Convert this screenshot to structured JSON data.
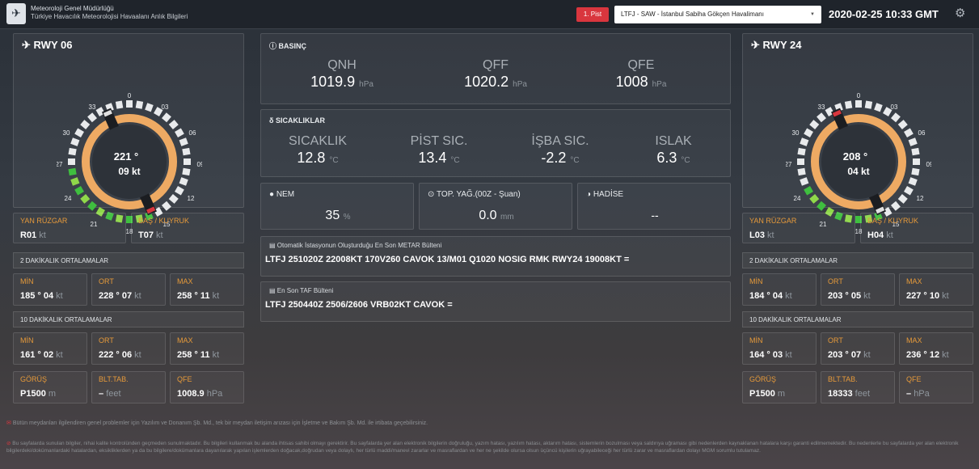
{
  "header": {
    "org_line1": "Meteoroloji Genel Müdürlüğü",
    "org_line2": "Türkiye Havacılık Meteorolojisi Havaalanı Anlık Bilgileri",
    "runway_button": "1. Pist",
    "airport_selected": "LTFJ - SAW - İstanbul Sabiha Gökçen Havalimanı",
    "datetime": "2020-02-25 10:33 GMT"
  },
  "left": {
    "title": "RWY 06",
    "wind_dir": "221 °",
    "wind_speed": "09 kt",
    "dial_labels": {
      "n0": "0",
      "n03": "03",
      "n06": "06",
      "n09": "09",
      "n12": "12",
      "n15": "15",
      "n18": "18",
      "n21": "21",
      "n24": "24",
      "n27": "27",
      "n30": "30",
      "n33": "33"
    },
    "crosswind": {
      "label": "YAN RÜZGAR",
      "value": "R01",
      "unit": "kt"
    },
    "headtail": {
      "label": "BAŞ / KUYRUK",
      "value": "T07",
      "unit": "kt"
    },
    "avg2_title": "2 DAKİKALIK ORTALAMALAR",
    "avg2": [
      {
        "label": "MİN",
        "value": "185 ° 04",
        "unit": "kt"
      },
      {
        "label": "ORT",
        "value": "228 ° 07",
        "unit": "kt"
      },
      {
        "label": "MAX",
        "value": "258 ° 11",
        "unit": "kt"
      }
    ],
    "avg10_title": "10 DAKİKALIK ORTALAMALAR",
    "avg10": [
      {
        "label": "MİN",
        "value": "161 ° 02",
        "unit": "kt"
      },
      {
        "label": "ORT",
        "value": "222 ° 06",
        "unit": "kt"
      },
      {
        "label": "MAX",
        "value": "258 ° 11",
        "unit": "kt"
      }
    ],
    "extra": [
      {
        "label": "GÖRÜŞ",
        "value": "P1500",
        "unit": "m"
      },
      {
        "label": "BLT.TAB.",
        "value": "–",
        "unit": "feet"
      },
      {
        "label": "QFE",
        "value": "1008.9",
        "unit": "hPa"
      }
    ]
  },
  "right": {
    "title": "RWY 24",
    "wind_dir": "208 °",
    "wind_speed": "04 kt",
    "dial_labels": {
      "n0": "0",
      "n03": "03",
      "n06": "06",
      "n09": "09",
      "n12": "12",
      "n15": "15",
      "n18": "18",
      "n21": "21",
      "n24": "24",
      "n27": "27",
      "n30": "30",
      "n33": "33"
    },
    "crosswind": {
      "label": "YAN RÜZGAR",
      "value": "L03",
      "unit": "kt"
    },
    "headtail": {
      "label": "BAŞ / KUYRUK",
      "value": "H04",
      "unit": "kt"
    },
    "avg2_title": "2 DAKİKALIK ORTALAMALAR",
    "avg2": [
      {
        "label": "MİN",
        "value": "184 ° 04",
        "unit": "kt"
      },
      {
        "label": "ORT",
        "value": "203 ° 05",
        "unit": "kt"
      },
      {
        "label": "MAX",
        "value": "227 ° 10",
        "unit": "kt"
      }
    ],
    "avg10_title": "10 DAKİKALIK ORTALAMALAR",
    "avg10": [
      {
        "label": "MİN",
        "value": "164 ° 03",
        "unit": "kt"
      },
      {
        "label": "ORT",
        "value": "203 ° 07",
        "unit": "kt"
      },
      {
        "label": "MAX",
        "value": "236 ° 12",
        "unit": "kt"
      }
    ],
    "extra": [
      {
        "label": "GÖRÜŞ",
        "value": "P1500",
        "unit": "m"
      },
      {
        "label": "BLT.TAB.",
        "value": "18333",
        "unit": "feet"
      },
      {
        "label": "QFE",
        "value": "–",
        "unit": "hPa"
      }
    ]
  },
  "pressure": {
    "title": "BASINÇ",
    "items": [
      {
        "label": "QNH",
        "value": "1019.9",
        "unit": "hPa"
      },
      {
        "label": "QFF",
        "value": "1020.2",
        "unit": "hPa"
      },
      {
        "label": "QFE",
        "value": "1008",
        "unit": "hPa"
      }
    ]
  },
  "temps": {
    "title": "SICAKLIKLAR",
    "items": [
      {
        "label": "SICAKLIK",
        "value": "12.8",
        "unit": "°C"
      },
      {
        "label": "PİST SIC.",
        "value": "13.4",
        "unit": "°C"
      },
      {
        "label": "İŞBA SIC.",
        "value": "-2.2",
        "unit": "°C"
      },
      {
        "label": "ISLAK",
        "value": "6.3",
        "unit": "°C"
      }
    ]
  },
  "humidity": {
    "title": "NEM",
    "value": "35",
    "unit": "%"
  },
  "precip": {
    "title": "TOP. YAĞ.(00Z - Şuan)",
    "value": "0.0",
    "unit": "mm"
  },
  "phenomena": {
    "title": "HADİSE",
    "value": "--"
  },
  "metar": {
    "title": "Otomatik İstasyonun Oluşturduğu En Son METAR Bülteni",
    "text": "LTFJ 251020Z 22008KT 170V260 CAVOK 13/M01 Q1020 NOSIG RMK RWY24 19008KT ="
  },
  "taf": {
    "title": "En Son TAF Bülteni",
    "text": "LTFJ 250440Z 2506/2606 VRB02KT CAVOK ="
  },
  "footer": {
    "line1": "Bütün meydanları ilgilendiren genel problemler için Yazılım ve Donanım Şb. Md., tek bir meydan iletişim arızası için İşletme ve Bakım Şb. Md. ile irtibata geçebilirsiniz.",
    "disclaimer": "Bu sayfalarda sunulan bilgiler, nihai kalite kontrolünden geçmeden sunulmaktadır. Bu bilgileri kullanmak bu alanda ihtisas sahibi olmayı gerektirir. Bu sayfalarda yer alan elektronik bilgilerin doğruluğu, yazım hatası, yazılım hatası, aktarım hatası, sistemlerin bozulması veya saldırıya uğraması gibi nedenlerden kaynaklanan hatalara karşı garanti edilmemektedir. Bu nedenlerle bu sayfalarda yer alan elektronik bilgilerdeki/dokümanlardaki hatalardan, eksikliklerden ya da bu bilgilere/dokümanlara dayanılarak yapılan işlemlerden doğacak,doğrudan veya dolaylı, her türlü maddi/manevi zararlar ve masraflardan ve her ne şekilde olursa olsun üçüncü kişilerin uğrayabileceği her türlü zarar ve masraflardan dolayı MGM sorumlu tutulamaz."
  },
  "colors": {
    "accent": "#e69a3a",
    "alert": "#d9363e",
    "green": "#3fbf3f",
    "ring": "#eeaa63"
  },
  "icons": {
    "logo": "mgm-logo-icon",
    "gear": "gear-icon",
    "plane": "plane-icon"
  }
}
